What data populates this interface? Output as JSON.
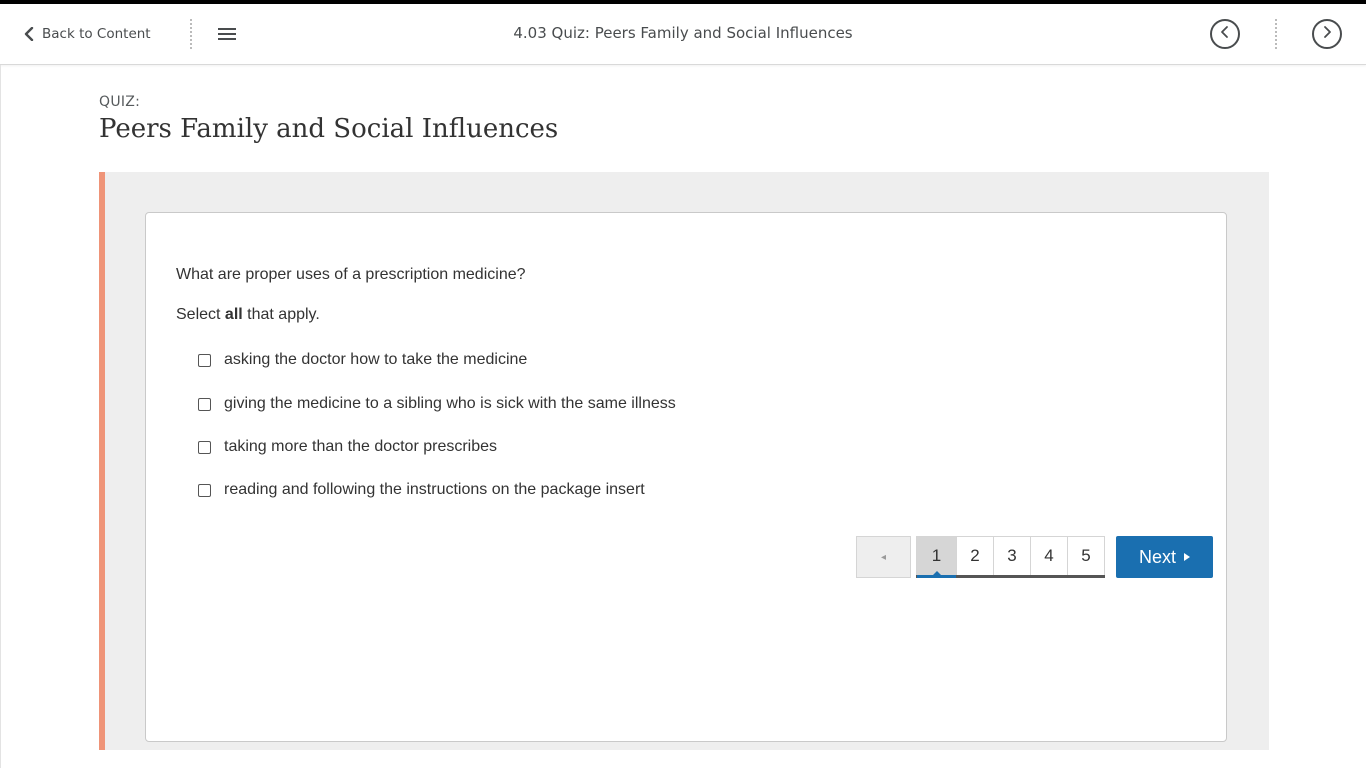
{
  "navbar": {
    "back_label": "Back to Content",
    "title": "4.03 Quiz: Peers Family and Social Influences",
    "icons": {
      "back": "chevron-left-icon",
      "menu": "hamburger-menu-icon",
      "prev": "circle-chevron-left-icon",
      "next": "circle-chevron-right-icon"
    }
  },
  "header": {
    "label": "QUIZ:",
    "title": "Peers Family and Social Influences"
  },
  "question": {
    "text": "What are proper uses of a prescription medicine?",
    "instruction_prefix": "Select ",
    "instruction_bold": "all",
    "instruction_suffix": " that apply.",
    "options": [
      "asking the doctor how to take the medicine",
      "giving the medicine to a sibling who is sick with the same illness",
      "taking more than the doctor prescribes",
      "reading and following the instructions on the package insert"
    ]
  },
  "pagination": {
    "prev_label": "◂",
    "pages": [
      "1",
      "2",
      "3",
      "4",
      "5"
    ],
    "current_page": "1",
    "next_label": "Next"
  },
  "colors": {
    "accent_bar": "#ef9478",
    "primary_button": "#1a6fb0",
    "panel_bg": "#eeeeee"
  }
}
